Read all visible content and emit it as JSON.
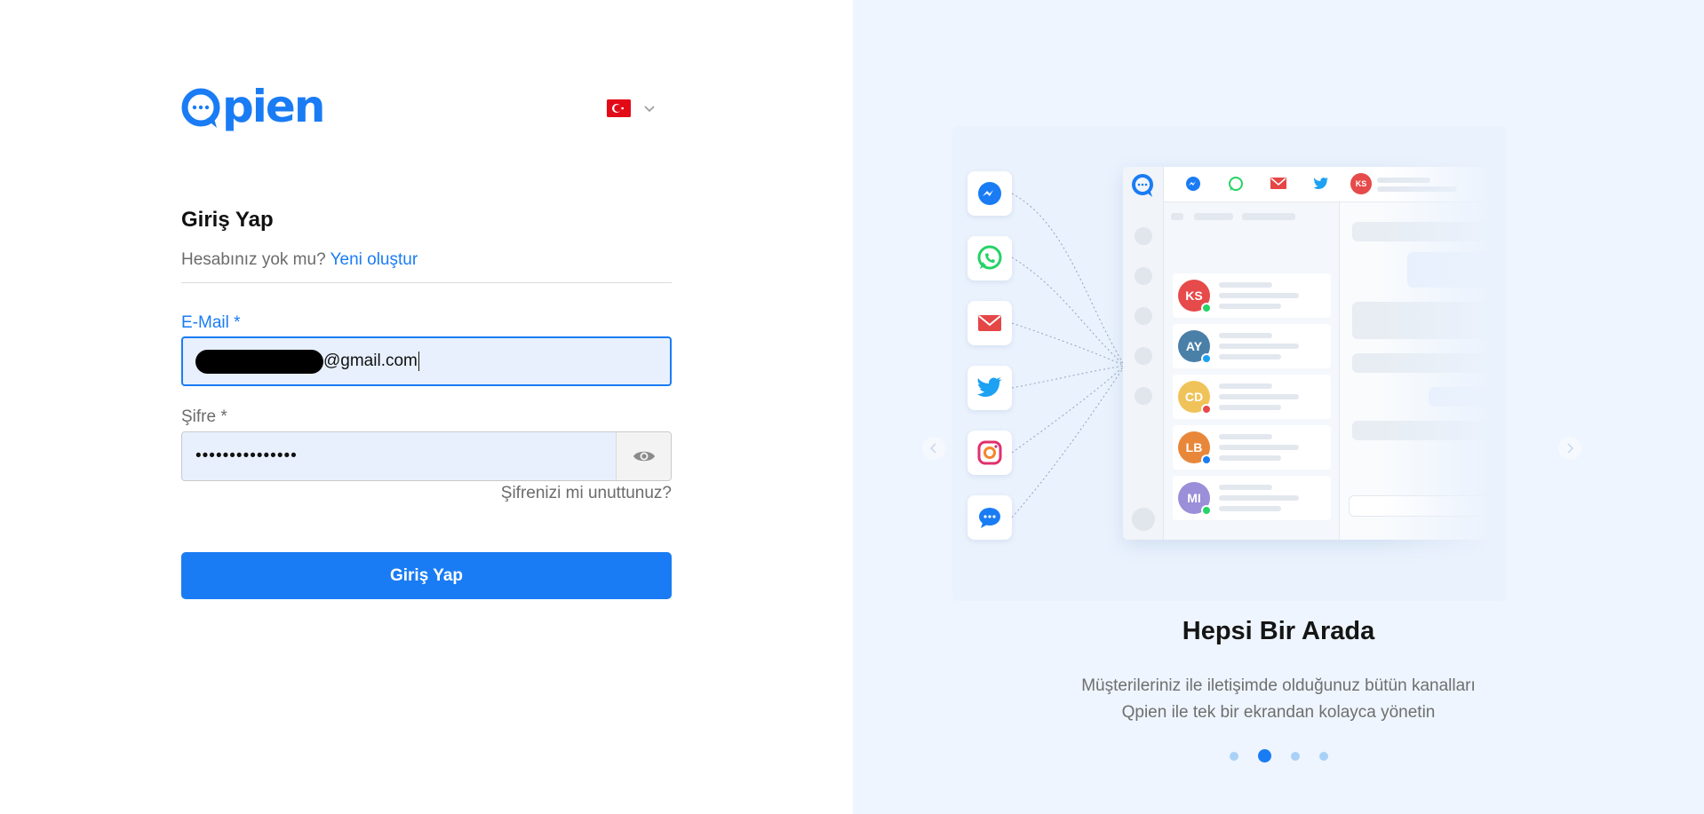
{
  "brand": {
    "name": "Qpien",
    "accent": "#1a7cf4"
  },
  "language": {
    "selected": "TR",
    "flag_icon": "turkey-flag-icon"
  },
  "login": {
    "title": "Giriş Yap",
    "no_account_text": "Hesabınız yok mu?",
    "create_link": "Yeni oluştur",
    "email_label": "E-Mail *",
    "email_value_suffix": "@gmail.com",
    "password_label": "Şifre *",
    "password_value": "•••••••••••••••",
    "forgot_link": "Şifrenizi mi unuttunuz?",
    "submit_label": "Giriş Yap"
  },
  "carousel": {
    "title": "Hepsi Bir Arada",
    "description_line1": "Müşterileriniz ile iletişimde olduğunuz bütün kanalları",
    "description_line2": "Qpien ile tek bir ekrandan kolayca yönetin",
    "slide_count": 4,
    "active_slide": 2,
    "channels": [
      "messenger",
      "whatsapp",
      "email",
      "twitter",
      "instagram",
      "chat"
    ],
    "contacts": [
      {
        "initials": "KS",
        "color": "#e64a4a",
        "badge": "#25d366"
      },
      {
        "initials": "AY",
        "color": "#4a7fa8",
        "badge": "#1da1f2"
      },
      {
        "initials": "CD",
        "color": "#f0c35a",
        "badge": "#e64a4a"
      },
      {
        "initials": "LB",
        "color": "#e8873a",
        "badge": "#1a7cf4"
      },
      {
        "initials": "MI",
        "color": "#9a8fd8",
        "badge": "#25d366"
      }
    ],
    "top_avatar": "KS"
  }
}
